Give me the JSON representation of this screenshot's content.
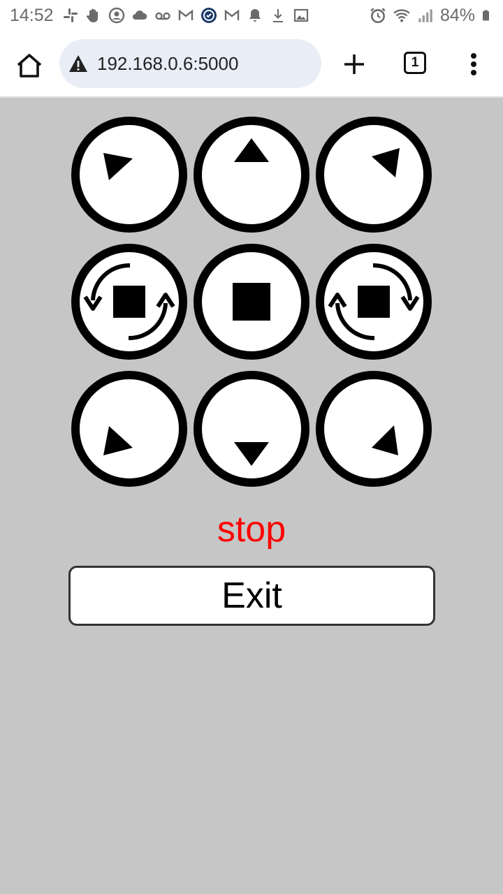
{
  "status_bar": {
    "time": "14:52",
    "notification_icons": [
      "slack-icon",
      "hand-icon",
      "account-icon",
      "cloud-icon",
      "voicemail-icon",
      "gmail-icon",
      "shield-app-icon",
      "gmail-icon",
      "bell-icon",
      "download-icon",
      "image-icon"
    ],
    "right_icons": [
      "alarm-icon",
      "wifi-icon",
      "signal-icon"
    ],
    "battery": "84%"
  },
  "browser": {
    "url": "192.168.0.6:5000",
    "tab_count": "1",
    "security_icon": "warning-icon"
  },
  "controls": [
    {
      "name": "forward-left",
      "icon": "forward-left-icon"
    },
    {
      "name": "forward",
      "icon": "up-arrow-icon"
    },
    {
      "name": "forward-right",
      "icon": "forward-right-icon"
    },
    {
      "name": "rotate-left",
      "icon": "rotate-left-icon"
    },
    {
      "name": "stop",
      "icon": "stop-icon"
    },
    {
      "name": "rotate-right",
      "icon": "rotate-right-icon"
    },
    {
      "name": "backward-left",
      "icon": "backward-left-icon"
    },
    {
      "name": "backward",
      "icon": "down-arrow-icon"
    },
    {
      "name": "backward-right",
      "icon": "backward-right-icon"
    }
  ],
  "status_text": "stop",
  "exit_label": "Exit",
  "colors": {
    "page_bg": "#c6c6c6",
    "status_text": "#ff0000",
    "url_bar_bg": "#e9eef6"
  }
}
